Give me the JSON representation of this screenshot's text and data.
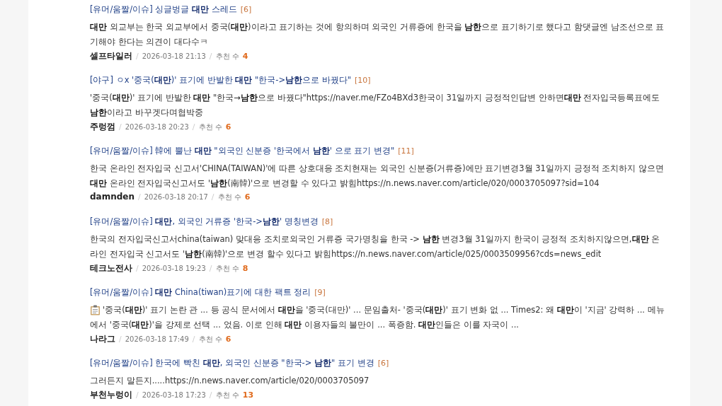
{
  "results": [
    {
      "title": "[유머/움짤/이슈] 싱글벙글 **대만** 스레드",
      "comments": "[6]",
      "body": "**대만** 외교부는 한국 외교부에서 중국(**대만**)이라고 표기하는 것에 항의하며 외국인 거류증에 한국을 **남한**으로 표기하기로 했다고 함댓글엔 남조선으로 표기해야 한다는 의견이 대다수ㅋ",
      "author": "셀프타일러",
      "separators": [
        "/",
        "/"
      ],
      "date": "2026-03-18 21:13",
      "recommend_label": "추천 수",
      "recommend_count": "4"
    },
    {
      "title": "[야구] ㅇx '중국(**대만**)' 표기에 반발한 **대만** \"한국->**남한**으로 바꿨다\"",
      "comments": "[10]",
      "body": "'중국(**대만**)' 표기에 반발한 **대만** \"한국→**남한**으로 바꿨다\"https://naver.me/FZo4BXd3한국이 31일까지 긍정적인답변 안하면**대만** 전자입국등록표에도 **남한**이라고 바꾸겟다며협박중",
      "author": "주렁껌",
      "separators": [
        "/",
        "/"
      ],
      "date": "2026-03-18 20:23",
      "recommend_label": "추천 수",
      "recommend_count": "6"
    },
    {
      "title": "[유머/움짤/이슈] 韓에 뿔난 **대만** \"외국인 신분증 '한국에서 **남한**' 으로 표기 변경\"",
      "comments": "[11]",
      "body": "한국 온라인 전자입국 신고서'CHINA(TAIWAN)'에 따른 상호대응 조치현재는 외국인 신분증(거류증)에만 표기변경3월 31일까지 긍정적 조치하지 않으면**대만** 온라인 전자입국신고서도 '**남한**(南韓)'으로 변경할 수 있다고 밝힘https://n.news.naver.com/article/020/0003705097?sid=104",
      "author": "damnden",
      "separators": [
        "/",
        "/"
      ],
      "date": "2026-03-18 20:17",
      "recommend_label": "추천 수",
      "recommend_count": "6"
    },
    {
      "title": "[유머/움짤/이슈] **대만**, 외국인 거류증 '한국->**남한**' 명칭변경",
      "comments": "[8]",
      "body": "한국의 전자입국신고서china(taiwan) 맞대응 조치로외국인 거류증 국가명칭을 한국 -> **남한** 변경3월 31일까지 한국이 긍정적 조치하지않으면,**대만** 온라인 전자입국 신고서도 '**남한**(南韓)'으로 변경 할수 있다고 밝힘https://n.news.naver.com/article/025/0003509956?cds=news_edit",
      "author": "테크노전사",
      "separators": [
        "/",
        "/"
      ],
      "date": "2026-03-18 19:23",
      "recommend_label": "추천 수",
      "recommend_count": "8"
    },
    {
      "title": "[유머/움짤/이슈] **대만** China(tiwan)표기에 대한 팩트 정리",
      "comments": "[9]",
      "kind": "clipboard",
      "body": "'중국(**대만**)' 표기 논란 관 ... 등 공식 문서에서 **대만**을 '중국(대만)' ... 문임출처- '중국(**대만**)' 표기 변화 없 ... Times2: 왜 **대만**이 '지금' 강력하 ... 메뉴에서 '중국(**대만**)'을 강제로 선택 ... 었음. 이로 인해 **대만** 이용자들의 불만이 ... 폭증함. **대만**인들은 이를 자국이 ...",
      "author": "나라그",
      "separators": [
        "/",
        "/"
      ],
      "date": "2026-03-18 17:49",
      "recommend_label": "추천 수",
      "recommend_count": "6"
    },
    {
      "title": "[유머/움짤/이슈] 한국에 빡친 **대만**, 외국인 신분증 \"한국-> **남한**\" 표기 변경",
      "comments": "[6]",
      "body": "그러든지 말든지.....https://n.news.naver.com/article/020/0003705097",
      "author": "부천누렁이",
      "separators": [
        "/",
        "/"
      ],
      "date": "2026-03-18 17:23",
      "recommend_label": "추천 수",
      "recommend_count": "13"
    }
  ]
}
